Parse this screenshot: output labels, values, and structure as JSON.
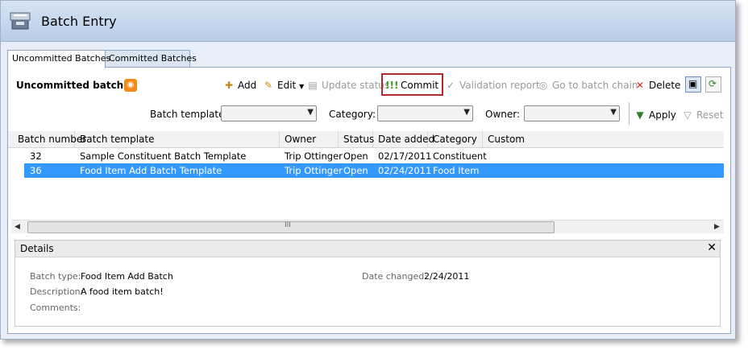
{
  "window": {
    "title": "Batch Entry",
    "icon": "batch-entry-icon"
  },
  "tabs": [
    {
      "label": "Uncommitted Batches",
      "active": true
    },
    {
      "label": "Committed Batches",
      "active": false
    }
  ],
  "section": {
    "title": "Uncommitted batches",
    "rss_icon": "rss-icon"
  },
  "toolbar": {
    "add": "Add",
    "edit": "Edit",
    "update_status": "Update status",
    "commit": "Commit",
    "validation_report": "Validation report",
    "go_to_batch_chain": "Go to batch chain",
    "delete": "Delete",
    "apply": "Apply",
    "reset": "Reset"
  },
  "filters": {
    "batch_template_label": "Batch template:",
    "category_label": "Category:",
    "owner_label": "Owner:"
  },
  "grid": {
    "columns": [
      "Batch number",
      "Batch template",
      "Owner",
      "Status",
      "Date added",
      "Category",
      "Custom"
    ],
    "rows": [
      {
        "number": "32",
        "template": "Sample Constituent Batch Template",
        "owner": "Trip Ottinger",
        "status": "Open",
        "date": "02/17/2011",
        "category": "Constituent",
        "custom": ""
      },
      {
        "number": "36",
        "template": "Food Item Add Batch Template",
        "owner": "Trip Ottinger",
        "status": "Open",
        "date": "02/24/2011",
        "category": "Food Item",
        "custom": ""
      }
    ],
    "scroll_grip": "III"
  },
  "details": {
    "title": "Details",
    "batch_type_label": "Batch type:",
    "batch_type": "Food Item Add Batch",
    "description_label": "Description:",
    "description": "A food item batch!",
    "comments_label": "Comments:",
    "date_changed_label": "Date changed:",
    "date_changed": "2/24/2011"
  },
  "colors": {
    "selection": "#3399ff",
    "commit_highlight": "#b0292b",
    "rss": "#f48a1a"
  }
}
